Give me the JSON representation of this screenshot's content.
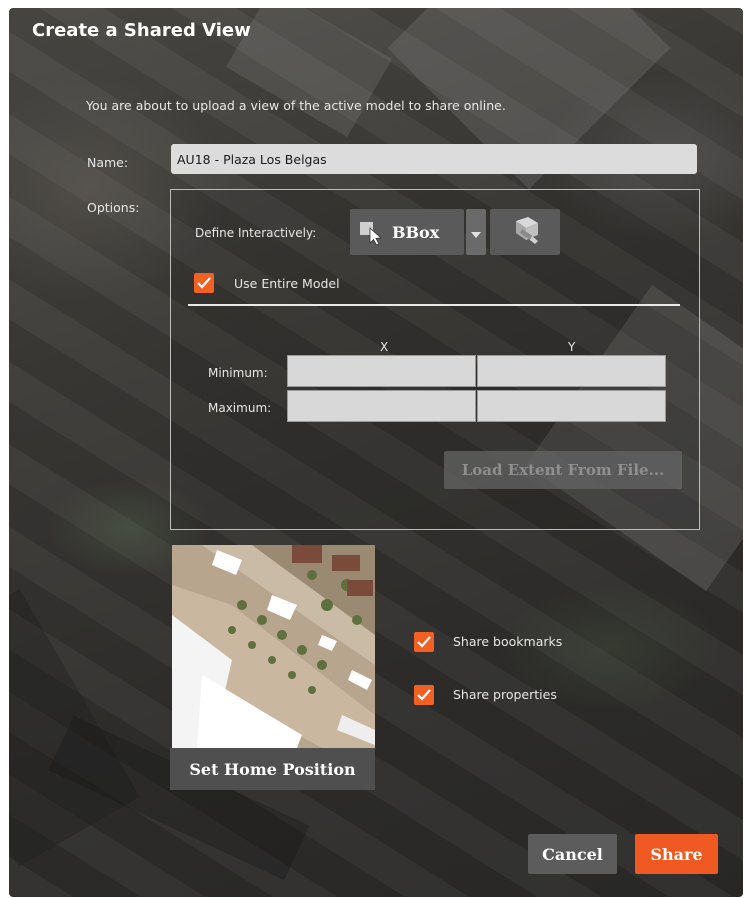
{
  "dialog": {
    "title": "Create a Shared View",
    "description": "You are about to upload a view of the active model to share online."
  },
  "name_field": {
    "label": "Name:",
    "value": "AU18 - Plaza Los Belgas"
  },
  "options": {
    "label": "Options:",
    "define_interactively_label": "Define Interactively:",
    "bbox_button_label": "BBox",
    "bbox_icon": "cursor-select-icon",
    "dropdown_icon": "chevron-down-icon",
    "tool_icon": "pick-extent-icon",
    "use_entire_model": {
      "label": "Use Entire Model",
      "checked": true
    },
    "extent_table": {
      "columns": [
        "X",
        "Y"
      ],
      "rows": [
        {
          "label": "Minimum:",
          "x": "",
          "y": ""
        },
        {
          "label": "Maximum:",
          "x": "",
          "y": ""
        }
      ]
    },
    "load_extent_button": "Load Extent From File..."
  },
  "preview": {
    "set_home_button": "Set Home Position"
  },
  "share_options": [
    {
      "label": "Share bookmarks",
      "checked": true
    },
    {
      "label": "Share properties",
      "checked": true
    }
  ],
  "footer": {
    "cancel_label": "Cancel",
    "share_label": "Share"
  },
  "colors": {
    "accent": "#f05a22",
    "button": "#5a5a5a",
    "input_bg": "#dcdcdc"
  }
}
